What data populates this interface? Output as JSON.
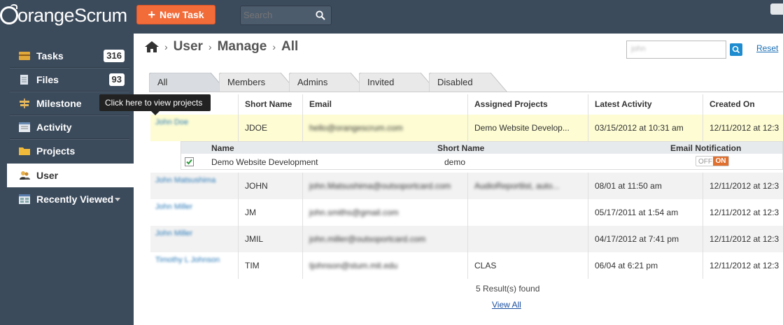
{
  "app": {
    "logo_text": "orangeScrum",
    "new_task_label": "New Task",
    "search_placeholder": "Search"
  },
  "sidebar": {
    "items": [
      {
        "label": "Tasks",
        "badge": "316"
      },
      {
        "label": "Files",
        "badge": "93"
      },
      {
        "label": "Milestone"
      },
      {
        "label": "Activity"
      },
      {
        "label": "Projects"
      },
      {
        "label": "User"
      },
      {
        "label": "Recently Viewed"
      }
    ],
    "tooltip": "Click here to view projects"
  },
  "breadcrumb": [
    "User",
    "Manage",
    "All"
  ],
  "user_search": {
    "value": "john"
  },
  "reset_label": "Reset",
  "tabs": [
    "All",
    "Members",
    "Admins",
    "Invited",
    "Disabled"
  ],
  "table": {
    "headers": [
      "Short Name",
      "Email",
      "Assigned Projects",
      "Latest Activity",
      "Created On"
    ],
    "rows": [
      {
        "name": "John Doe",
        "short": "JDOE",
        "email": "hello@orangescrum.com",
        "projects": "Demo Website Develop...",
        "activity": "03/15/2012 at 10:31 am",
        "created": "12/11/2012 at 12:3"
      },
      {
        "name": "John Matsushima",
        "short": "JOHN",
        "email": "john.Matsushima@outsoportcard.com",
        "projects": "AudioReportlist, auto...",
        "activity": "08/01 at 11:50 am",
        "created": "12/11/2012 at 12:3"
      },
      {
        "name": "John Miller",
        "short": "JM",
        "email": "john.smiths@gmail.com",
        "projects": "",
        "activity": "05/17/2011 at 1:54 am",
        "created": "12/11/2012 at 12:3"
      },
      {
        "name": "John Miller",
        "short": "JMIL",
        "email": "john.miller@outsoportcard.com",
        "projects": "",
        "activity": "04/17/2012 at 7:41 pm",
        "created": "12/11/2012 at 12:3"
      },
      {
        "name": "Timothy L Johnson",
        "short": "TIM",
        "email": "tjohnson@stum.mit.edu",
        "projects": "CLAS",
        "activity": "06/04 at 6:21 pm",
        "created": "12/11/2012 at 12:3"
      }
    ]
  },
  "subtable": {
    "headers": [
      "Name",
      "Short Name",
      "Email Notification"
    ],
    "row": {
      "name": "Demo Website Development",
      "short": "demo",
      "toggle_off": "OFF",
      "toggle_on": "ON"
    }
  },
  "results_text": "5 Result(s) found",
  "view_all_label": "View All",
  "colors": {
    "topbar": "#3c4b5c",
    "accent": "#f26c3a",
    "highlight_row": "#fdfcd3",
    "link": "#1a6fb5"
  }
}
